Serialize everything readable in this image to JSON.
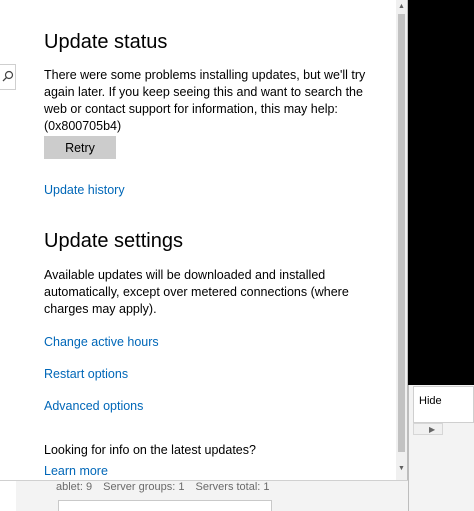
{
  "update_status": {
    "title": "Update status",
    "message": "There were some problems installing updates, but we'll try again later. If you keep seeing this and want to search the web or contact support for information, this may help: (0x800705b4)",
    "retry_label": "Retry",
    "history_link": "Update history"
  },
  "update_settings": {
    "title": "Update settings",
    "description": "Available updates will be downloaded and installed automatically, except over metered connections (where charges may apply).",
    "links": {
      "active_hours": "Change active hours",
      "restart_options": "Restart options",
      "advanced_options": "Advanced options"
    }
  },
  "info": {
    "question": "Looking for info on the latest updates?",
    "learn_more": "Learn more"
  },
  "background": {
    "hide_label": "Hide",
    "status_bar": [
      "ablet: 9",
      "Server groups: 1",
      "Servers total: 1"
    ]
  },
  "colors": {
    "link": "#0067b8",
    "button": "#cccccc",
    "background": "#ffffff"
  },
  "icons": {
    "search": "search-icon",
    "scroll_up": "chevron-up-icon",
    "scroll_down": "chevron-down-icon",
    "scroll_right": "chevron-right-icon"
  }
}
